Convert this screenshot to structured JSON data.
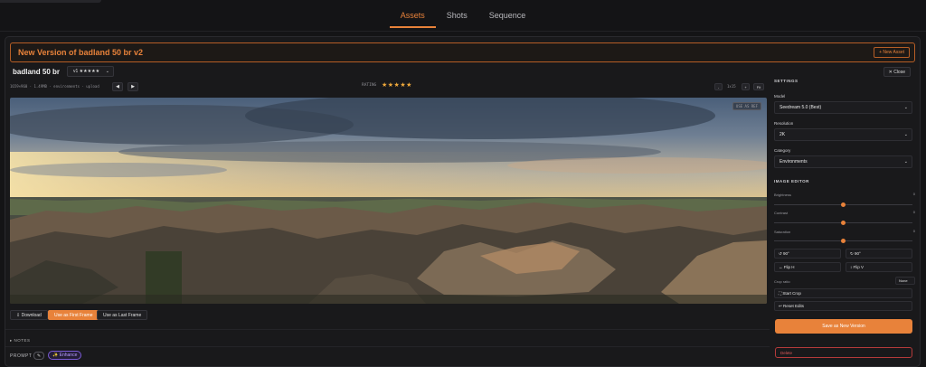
{
  "tabs": [
    {
      "label": "Assets",
      "active": true
    },
    {
      "label": "Shots",
      "active": false
    },
    {
      "label": "Sequence",
      "active": false
    }
  ],
  "header": {
    "title": "New Version of badland 50 br v2",
    "new_asset_label": "+ New Asset"
  },
  "asset": {
    "name": "badland 50 br",
    "version_label": "v1 ★★★★★",
    "close_label": "✕ Close",
    "meta": "1659×960 · 1.49MB · environments · upload",
    "prev_icon": "◀",
    "next_icon": "▶",
    "rating_label": "RATING",
    "rating_stars": "★★★★★",
    "rating_value": 5,
    "zoom_out": "-",
    "zoom_level": "1x15",
    "zoom_in": "+",
    "zoom_fit": "Fit",
    "ref_badge": "USE AS REF"
  },
  "actions": {
    "download": "⇩ Download",
    "first_frame": "Use as First Frame",
    "last_frame": "Use as Last Frame"
  },
  "notes_label": "▸ NOTES",
  "prompt": {
    "label": "PROMPT",
    "pencil_icon": "✎",
    "enhance_label": "✨ Enhance"
  },
  "settings": {
    "title": "SETTINGS",
    "model_label": "Model",
    "model_value": "Seedream 5.0 (Best)",
    "resolution_label": "Resolution",
    "resolution_value": "2K",
    "category_label": "Category",
    "category_value": "Environments"
  },
  "image_editor": {
    "title": "IMAGE EDITOR",
    "sliders": [
      {
        "label": "Brightness",
        "value": "0",
        "level": 0.5
      },
      {
        "label": "Contrast",
        "value": "0",
        "level": 0.5
      },
      {
        "label": "Saturation",
        "value": "0",
        "level": 0.5
      }
    ],
    "rotate_left": "↺ 90°",
    "rotate_right": "↻ 90°",
    "flip_h": "↔ Flip H",
    "flip_v": "↕ Flip V",
    "crop_ratio_label": "Crop ratio",
    "crop_ratio_value": "None",
    "start_crop": "⛶ Start Crop",
    "reset_edits": "↩ Reset Edits"
  },
  "save_label": "Save as New Version",
  "delete_label": "Delete",
  "colors": {
    "accent": "#e8823a",
    "background": "#141416",
    "panel": "#19191b",
    "delete": "#e05a5a",
    "enhance": "#b59bff"
  }
}
